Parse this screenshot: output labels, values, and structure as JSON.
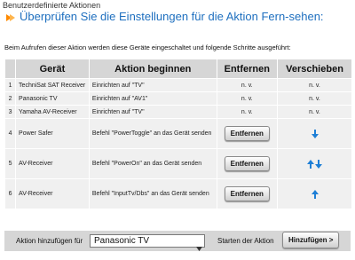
{
  "header": {
    "section_label": "Benutzerdefinierte Aktionen",
    "title": "Überprüfen Sie die Einstellungen für die Aktion Fern-sehen:",
    "icon": "bullet-arrow-icon"
  },
  "intro": "Beim Aufrufen dieser Aktion werden diese Geräte eingeschaltet und folgende Schritte ausgeführt:",
  "table": {
    "headers": {
      "device": "Gerät",
      "action": "Aktion beginnen",
      "remove": "Entfernen",
      "move": "Verschieben"
    },
    "rows": [
      {
        "num": "1",
        "device": "TechniSat SAT Receiver",
        "action": "Einrichten auf \"TV\"",
        "remove": "n. v.",
        "move": "n. v."
      },
      {
        "num": "2",
        "device": "Panasonic TV",
        "action": "Einrichten auf \"AV1\"",
        "remove": "n. v.",
        "move": "n. v."
      },
      {
        "num": "3",
        "device": "Yamaha AV-Receiver",
        "action": "Einrichten auf \"TV\"",
        "remove": "n. v.",
        "move": "n. v."
      },
      {
        "num": "4",
        "device": "Power Safer",
        "action": "Befehl \"PowerToggle\" an das Gerät senden",
        "remove": "Entfernen"
      },
      {
        "num": "5",
        "device": "AV-Receiver",
        "action": "Befehl \"PowerOn\" an das Gerät senden",
        "remove": "Entfernen"
      },
      {
        "num": "6",
        "device": "AV-Receiver",
        "action": "Befehl \"InputTv/Dbs\" an das Gerät senden",
        "remove": "Entfernen"
      }
    ]
  },
  "footer": {
    "add_label": "Aktion hinzufügen für",
    "selected_device": "Panasonic TV",
    "start_label": "Starten der Aktion",
    "add_button": "Hinzufügen >"
  },
  "colors": {
    "accent": "#1e6fbf",
    "arrow": "#1e7fd6",
    "header_bg": "#d6d6d6",
    "row_bg": "#f0f0f0"
  }
}
